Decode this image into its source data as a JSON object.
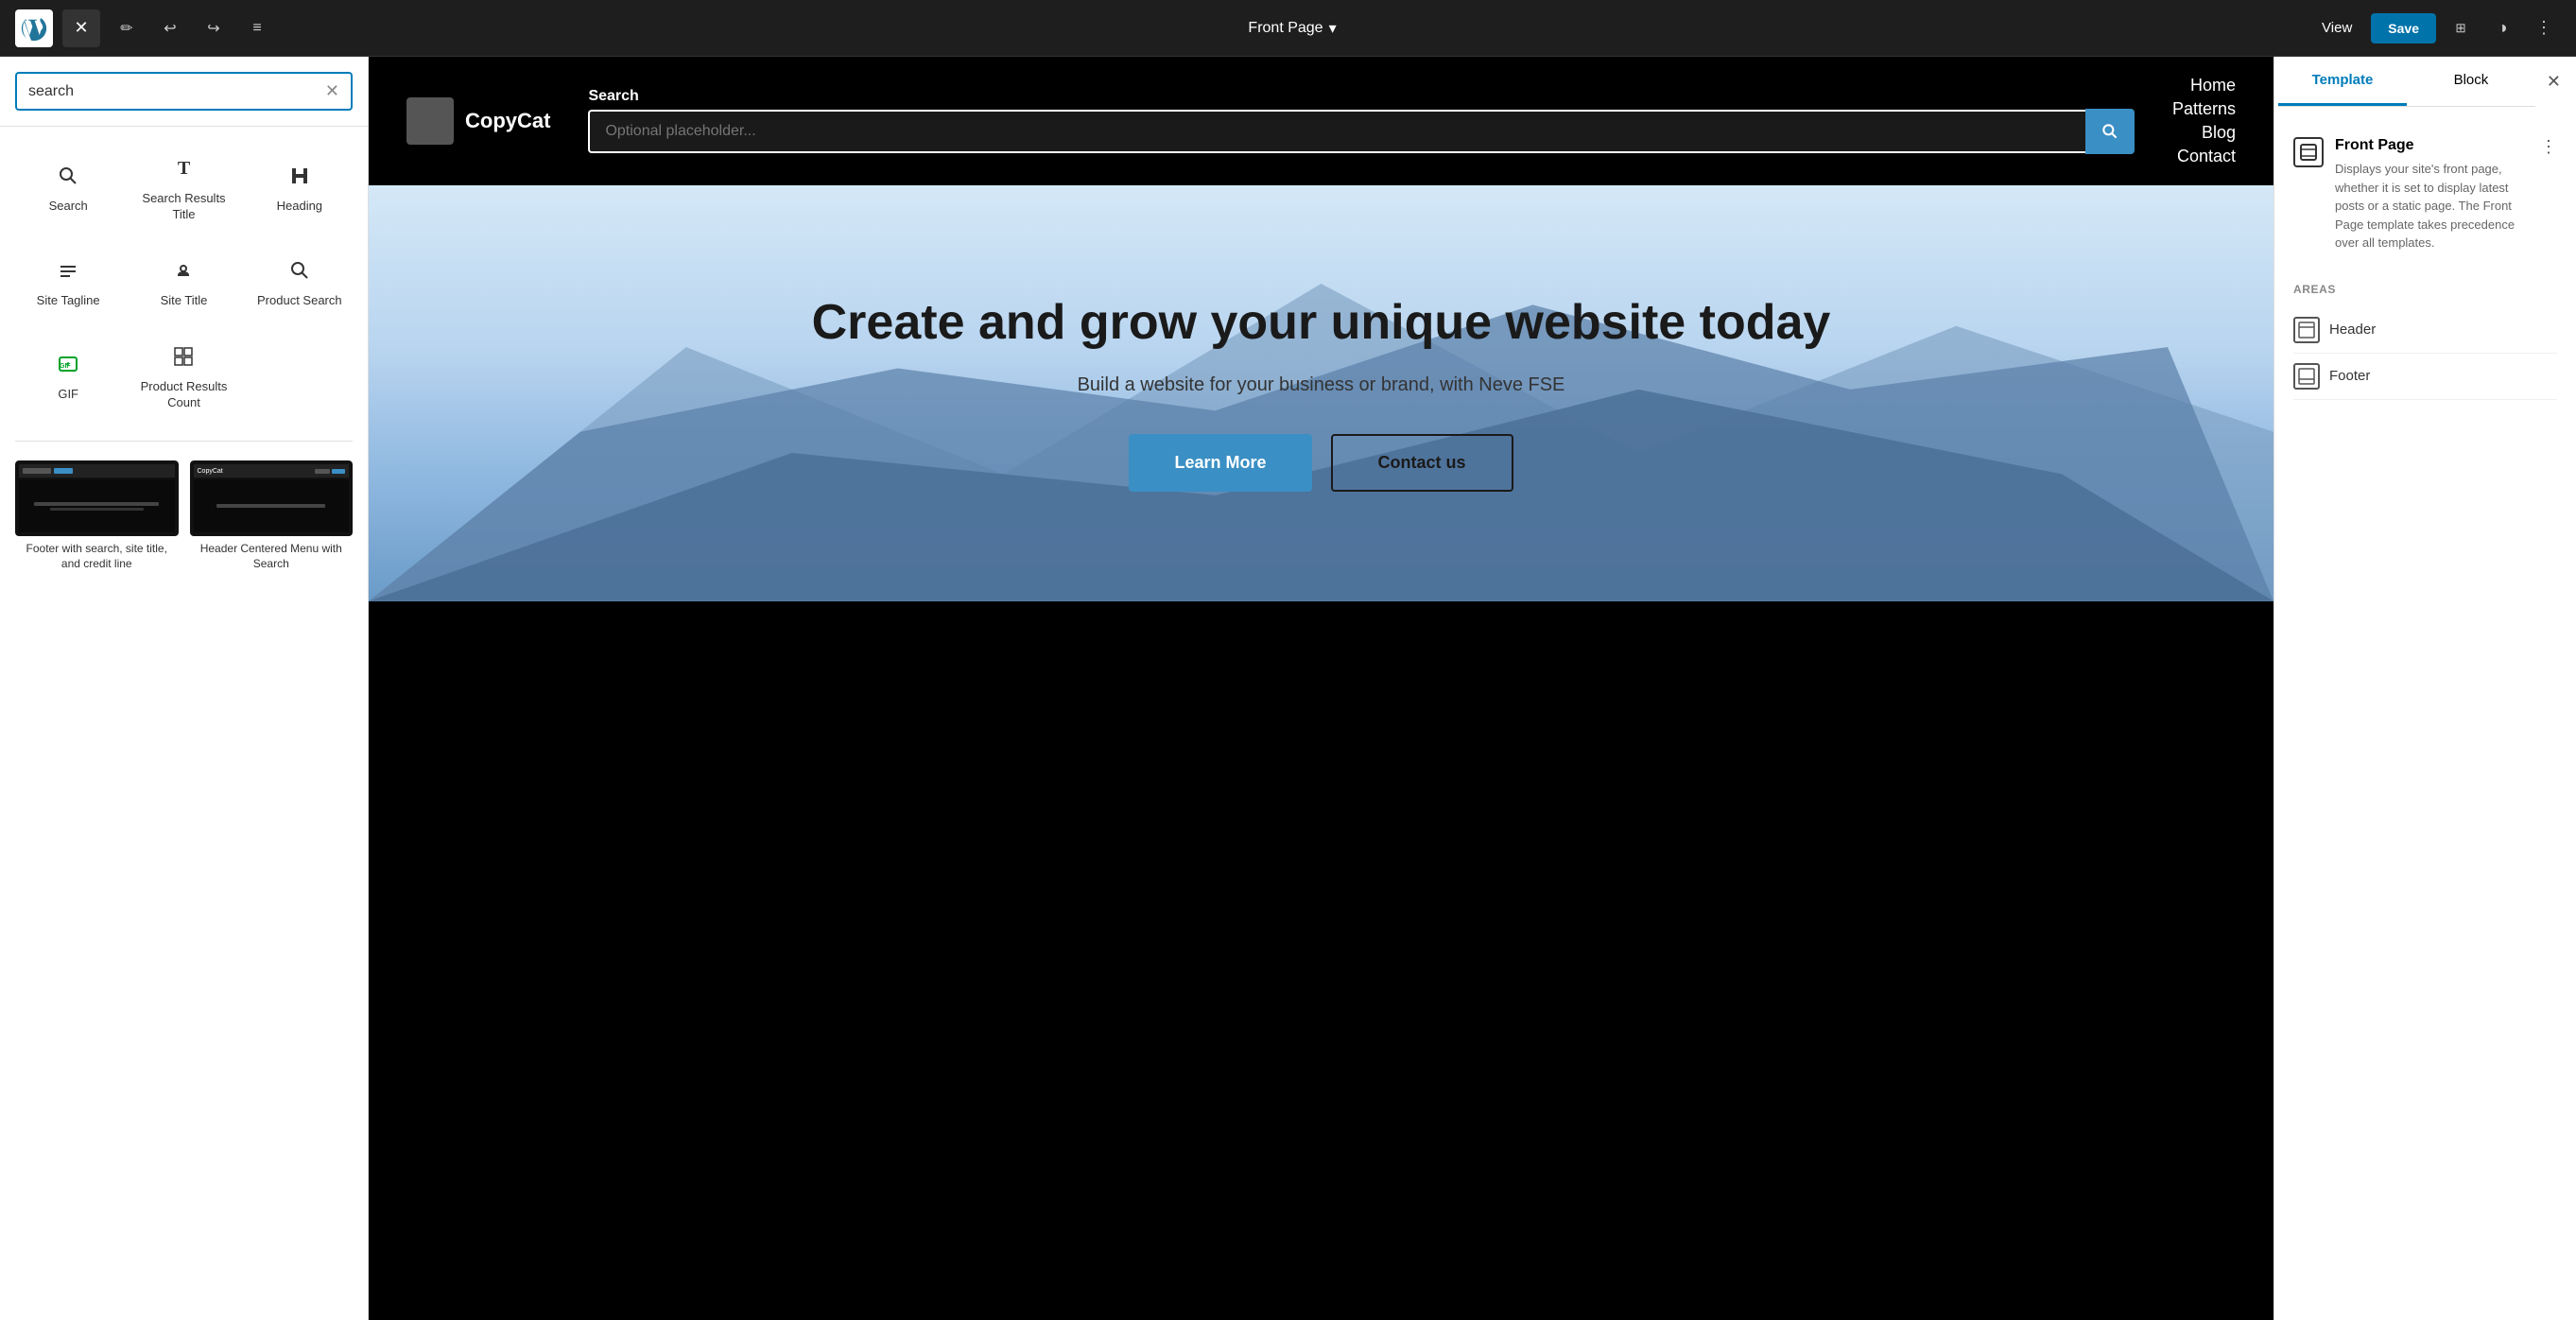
{
  "toolbar": {
    "page_title": "Front Page",
    "view_label": "View",
    "save_label": "Save",
    "close_icon": "✕",
    "pencil_icon": "✏",
    "undo_icon": "↩",
    "redo_icon": "↪",
    "list_icon": "≡",
    "layout_icon": "⊞",
    "contrast_icon": "◑",
    "more_icon": "⋮",
    "chevron_icon": "⌄"
  },
  "left_panel": {
    "search_placeholder": "search",
    "search_value": "search",
    "blocks": [
      {
        "id": "search",
        "label": "Search",
        "icon": "🔍"
      },
      {
        "id": "search-results-title",
        "label": "Search Results Title",
        "icon": "T"
      },
      {
        "id": "heading",
        "label": "Heading",
        "icon": "🔖"
      },
      {
        "id": "site-tagline",
        "label": "Site Tagline",
        "icon": "≡"
      },
      {
        "id": "site-title",
        "label": "Site Title",
        "icon": "📍"
      },
      {
        "id": "product-search",
        "label": "Product Search",
        "icon": "🔍"
      },
      {
        "id": "gif",
        "label": "GIF",
        "icon": "🖼"
      },
      {
        "id": "product-results-count",
        "label": "Product Results Count",
        "icon": "▦"
      }
    ],
    "patterns": [
      {
        "id": "footer-search",
        "label": "Footer with search, site title, and credit line"
      },
      {
        "id": "header-centered",
        "label": "Header Centered Menu with Search"
      }
    ]
  },
  "canvas": {
    "header": {
      "logo_alt": "CopyCat",
      "logo_text": "CopyCat",
      "search_label": "Search",
      "search_placeholder": "Optional placeholder...",
      "nav_items": [
        "Home",
        "Patterns",
        "Blog",
        "Contact"
      ]
    },
    "hero": {
      "title": "Create and grow your unique website today",
      "subtitle": "Build a website for your business or brand, with Neve FSE",
      "btn_primary": "Learn More",
      "btn_secondary": "Contact us"
    }
  },
  "right_panel": {
    "tab_template": "Template",
    "tab_block": "Block",
    "template_name": "Front Page",
    "template_description": "Displays your site's front page, whether it is set to display latest posts or a static page. The Front Page template takes precedence over all templates.",
    "areas_label": "AREAS",
    "areas": [
      {
        "id": "header",
        "label": "Header"
      },
      {
        "id": "footer",
        "label": "Footer"
      }
    ]
  }
}
